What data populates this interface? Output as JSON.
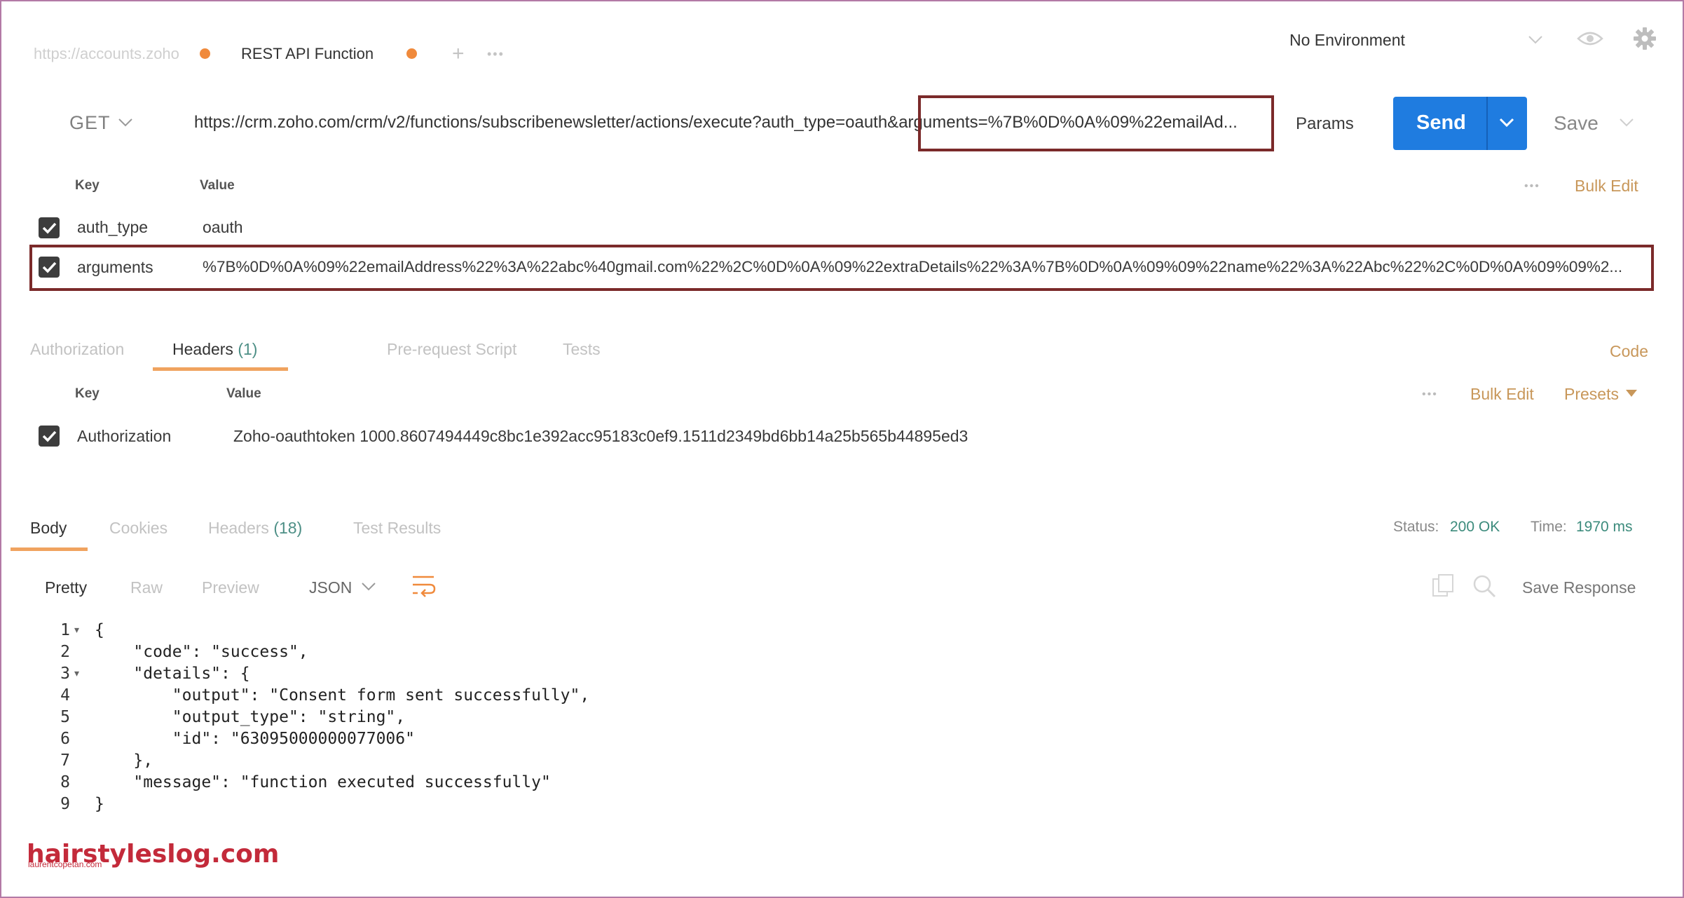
{
  "tabs": {
    "items": [
      {
        "label": "https://accounts.zoho"
      },
      {
        "label": "REST API Function"
      }
    ],
    "add_glyph": "+",
    "more_glyph": "•••"
  },
  "environment": {
    "label": "No Environment"
  },
  "request": {
    "method": "GET",
    "url": "https://crm.zoho.com/crm/v2/functions/subscribenewsletter/actions/execute?auth_type=oauth&arguments=%7B%0D%0A%09%22emailAd...",
    "params_label": "Params",
    "send_label": "Send",
    "save_label": "Save"
  },
  "params": {
    "key_header": "Key",
    "value_header": "Value",
    "bulk_edit": "Bulk Edit",
    "rows": [
      {
        "key": "auth_type",
        "value": "oauth"
      },
      {
        "key": "arguments",
        "value": "%7B%0D%0A%09%22emailAddress%22%3A%22abc%40gmail.com%22%2C%0D%0A%09%22extraDetails%22%3A%7B%0D%0A%09%09%22name%22%3A%22Abc%22%2C%0D%0A%09%09%2..."
      }
    ]
  },
  "request_tabs": {
    "authorization": "Authorization",
    "headers": "Headers",
    "headers_count": "(1)",
    "pre_request": "Pre-request Script",
    "tests": "Tests",
    "code": "Code"
  },
  "headers": {
    "key_header": "Key",
    "value_header": "Value",
    "bulk_edit": "Bulk Edit",
    "presets": "Presets",
    "rows": [
      {
        "key": "Authorization",
        "value": "Zoho-oauthtoken 1000.8607494449c8bc1e392acc95183c0ef9.1511d2349bd6bb14a25b565b44895ed3"
      }
    ]
  },
  "response_tabs": {
    "body": "Body",
    "cookies": "Cookies",
    "headers": "Headers",
    "headers_count": "(18)",
    "test_results": "Test Results",
    "status_label": "Status:",
    "status_value": "200 OK",
    "time_label": "Time:",
    "time_value": "1970 ms"
  },
  "response_view": {
    "pretty": "Pretty",
    "raw": "Raw",
    "preview": "Preview",
    "format": "JSON",
    "save_response": "Save Response"
  },
  "response_body": {
    "lines": [
      {
        "num": "1",
        "fold": "▾",
        "text": "{"
      },
      {
        "num": "2",
        "fold": "",
        "text": "    \"code\": \"success\","
      },
      {
        "num": "3",
        "fold": "▾",
        "text": "    \"details\": {"
      },
      {
        "num": "4",
        "fold": "",
        "text": "        \"output\": \"Consent form sent successfully\","
      },
      {
        "num": "5",
        "fold": "",
        "text": "        \"output_type\": \"string\","
      },
      {
        "num": "6",
        "fold": "",
        "text": "        \"id\": \"63095000000077006\""
      },
      {
        "num": "7",
        "fold": "",
        "text": "    },"
      },
      {
        "num": "8",
        "fold": "",
        "text": "    \"message\": \"function executed successfully\""
      },
      {
        "num": "9",
        "fold": "",
        "text": "}"
      }
    ]
  },
  "watermark": {
    "main": "hairstyleslog.com",
    "sub": "laurentcopetan.com"
  },
  "colors": {
    "accent_orange": "#f08a3c",
    "send_blue": "#1f7ce0",
    "highlight_red": "#7b2a2a",
    "link_gold": "#c8975a",
    "status_teal": "#3c8b7c"
  }
}
